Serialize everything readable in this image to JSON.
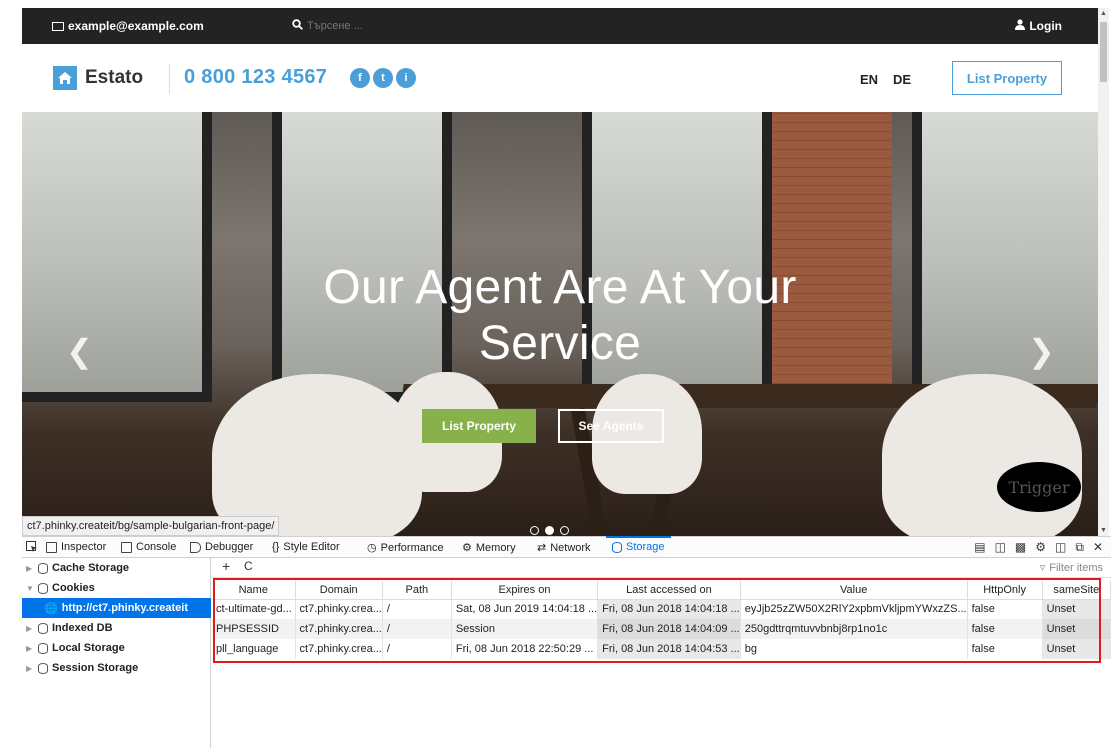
{
  "site": {
    "email": "example@example.com",
    "search_placeholder": "Търсене ...",
    "login": "Login",
    "logo_name": "Estato",
    "phone": "0 800 123 4567",
    "socials": [
      "f",
      "t",
      "i"
    ],
    "languages": [
      "EN",
      "DE"
    ],
    "header_button": "List Property",
    "hero_title_line1": "Our Agent Are At Your",
    "hero_title_line2": "Service",
    "hero_button_primary": "List Property",
    "hero_button_secondary": "See Agents",
    "trigger": "Trigger",
    "status_url": "ct7.phinky.createit/bg/sample-bulgarian-front-page/",
    "colors": {
      "accent": "#4a9fd8",
      "green": "#88b04b",
      "topbar": "#232323"
    }
  },
  "devtools": {
    "tabs": [
      "Inspector",
      "Console",
      "Debugger",
      "Style Editor",
      "Performance",
      "Memory",
      "Network",
      "Storage"
    ],
    "active_tab": "Storage",
    "sidebar": {
      "cache_storage": "Cache Storage",
      "cookies": "Cookies",
      "cookie_host": "http://ct7.phinky.createit",
      "indexed_db": "Indexed DB",
      "local_storage": "Local Storage",
      "session_storage": "Session Storage"
    },
    "toolbar": {
      "add": "+",
      "refresh": "C",
      "filter_placeholder": "Filter items"
    },
    "columns": [
      "Name",
      "Domain",
      "Path",
      "Expires on",
      "Last accessed on",
      "Value",
      "HttpOnly",
      "sameSite"
    ],
    "rows": [
      [
        "ct-ultimate-gd...",
        "ct7.phinky.crea...",
        "/",
        "Sat, 08 Jun 2019 14:04:18 ...",
        "Fri, 08 Jun 2018 14:04:18 ...",
        "eyJjb25zZW50X2RlY2xpbmVkljpmYWxzZS...",
        "false",
        "Unset"
      ],
      [
        "PHPSESSID",
        "ct7.phinky.crea...",
        "/",
        "Session",
        "Fri, 08 Jun 2018 14:04:09 ...",
        "250gdttrqmtuvvbnbj8rp1no1c",
        "false",
        "Unset"
      ],
      [
        "pll_language",
        "ct7.phinky.crea...",
        "/",
        "Fri, 08 Jun 2018 22:50:29 ...",
        "Fri, 08 Jun 2018 14:04:53 ...",
        "bg",
        "false",
        "Unset"
      ]
    ]
  }
}
